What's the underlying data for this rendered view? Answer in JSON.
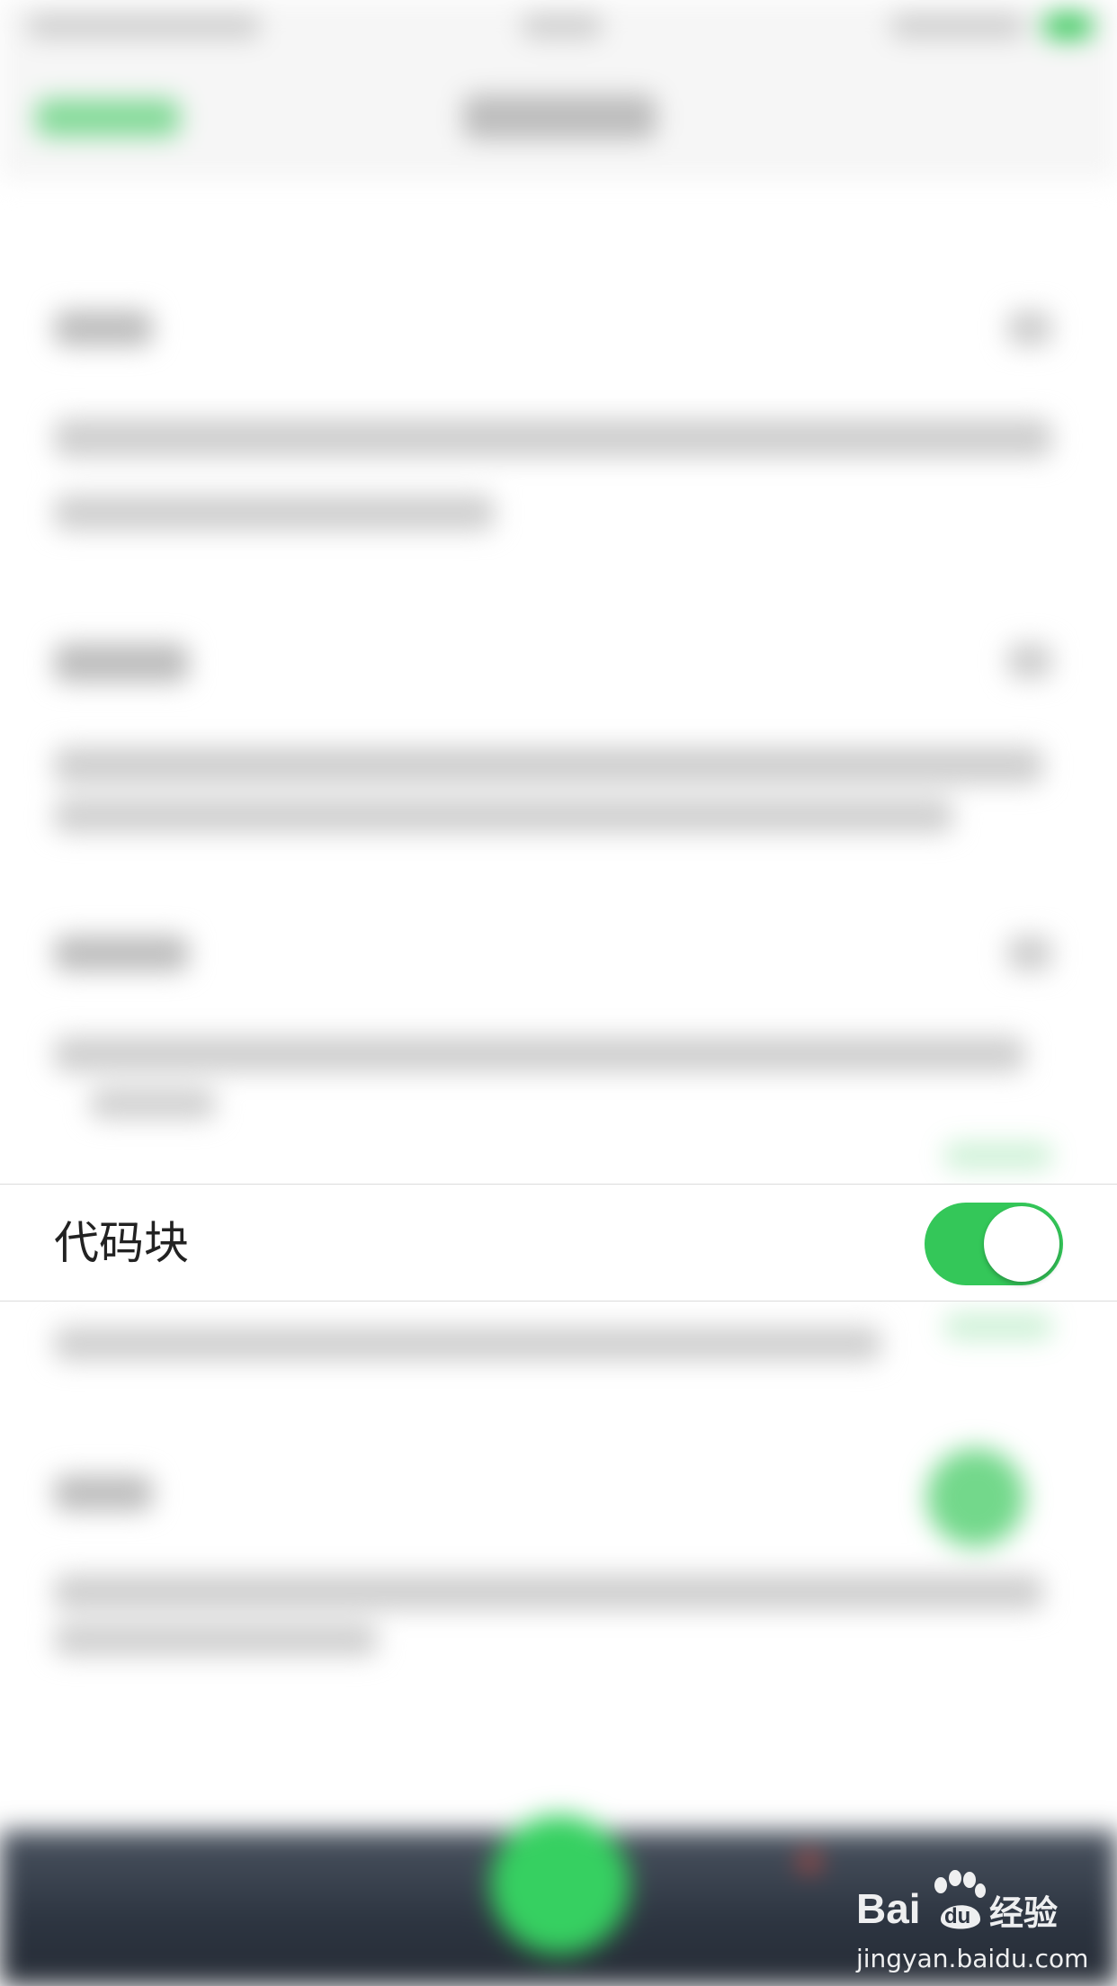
{
  "row": {
    "label": "代码块",
    "toggle_on": true
  },
  "watermark": {
    "logo_text": "Bai 经验",
    "url": "jingyan.baidu.com"
  },
  "colors": {
    "toggle_green": "#34c759",
    "fab_green": "#36d061",
    "bottom_bar": "#2c3440"
  }
}
